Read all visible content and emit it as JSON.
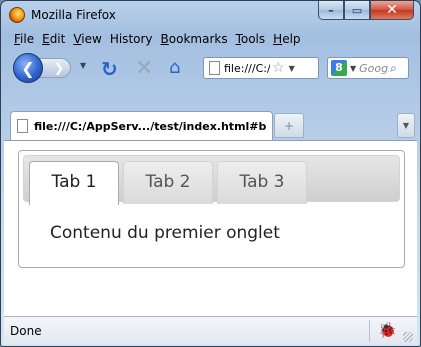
{
  "window": {
    "title": "Mozilla Firefox",
    "minimize": "–",
    "maximize": "▭",
    "close": "✕"
  },
  "menubar": {
    "items": [
      {
        "first": "F",
        "rest": "ile"
      },
      {
        "first": "E",
        "rest": "dit"
      },
      {
        "first": "V",
        "rest": "iew"
      },
      {
        "first": "",
        "rest": "History"
      },
      {
        "first": "B",
        "rest": "ookmarks"
      },
      {
        "first": "T",
        "rest": "ools"
      },
      {
        "first": "H",
        "rest": "elp"
      }
    ]
  },
  "toolbar": {
    "back_glyph": "❮",
    "forward_glyph": "❯",
    "dropdown_glyph": "▼",
    "reload_glyph": "↻",
    "stop_glyph": "✕",
    "home_glyph": "⌂",
    "star_glyph": "☆",
    "url_value": "file:///C:/AppServ/www/test/index.html#b",
    "search_engine_glyph": "8",
    "search_placeholder": "Google",
    "search_glyph": "⌕"
  },
  "browser_tabs": {
    "items": [
      {
        "label": "file:///C:/AppServ.../test/index.html#b"
      }
    ],
    "new_tab_glyph": "+",
    "list_glyph": "▼"
  },
  "page": {
    "tabs": [
      {
        "label": "Tab 1",
        "active": true
      },
      {
        "label": "Tab 2",
        "active": false
      },
      {
        "label": "Tab 3",
        "active": false
      }
    ],
    "panel_text": "Contenu du premier onglet"
  },
  "statusbar": {
    "text": "Done",
    "icon": "firebug-icon"
  }
}
